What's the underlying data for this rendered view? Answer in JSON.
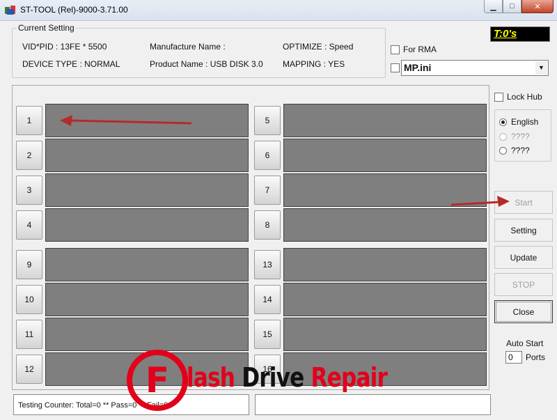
{
  "window": {
    "title": "ST-TOOL (Rel)-9000-3.71.00",
    "minimize_glyph": "▁",
    "maximize_glyph": "□",
    "close_glyph": "✕"
  },
  "current_setting": {
    "legend": "Current Setting",
    "vid_pid": "VID*PID : 13FE * 5500",
    "manufacture_name": "Manufacture Name :",
    "optimize": "OPTIMIZE : Speed",
    "device_type": "DEVICE TYPE : NORMAL",
    "product_name": "Product Name : USB DISK 3.0",
    "mapping": "MAPPING : YES"
  },
  "timer": "T:0's",
  "for_rma": {
    "label": "For RMA",
    "checked": false
  },
  "ini_select": {
    "checked": false,
    "value": "MP.ini",
    "arrow": "▼"
  },
  "ports": {
    "left": [
      "1",
      "2",
      "3",
      "4",
      "9",
      "10",
      "11",
      "12"
    ],
    "right": [
      "5",
      "6",
      "7",
      "8",
      "13",
      "14",
      "15",
      "16"
    ]
  },
  "status": {
    "testing_counter": "Testing Counter: Total=0 ** Pass=0 ** Fail=0"
  },
  "lock_hub": {
    "label": "Lock Hub",
    "checked": false
  },
  "language": {
    "options": [
      {
        "label": "English",
        "selected": true,
        "disabled": false
      },
      {
        "label": "????",
        "selected": false,
        "disabled": true
      },
      {
        "label": "????",
        "selected": false,
        "disabled": false
      }
    ]
  },
  "buttons": {
    "start": "Start",
    "setting": "Setting",
    "update": "Update",
    "stop": "STOP",
    "close": "Close"
  },
  "auto_start": {
    "label": "Auto Start",
    "value": "0",
    "unit": "Ports"
  },
  "watermark": {
    "logo_letter": "F",
    "text_red_1": "lash",
    "text_black": "Drive",
    "text_red_2": "Repair"
  },
  "colors": {
    "panel_gray": "#7f7f7f",
    "timer_bg": "#000000",
    "timer_fg": "#ffff00",
    "annotation_arrow": "#b52a2a",
    "watermark_red": "#e2001a"
  }
}
